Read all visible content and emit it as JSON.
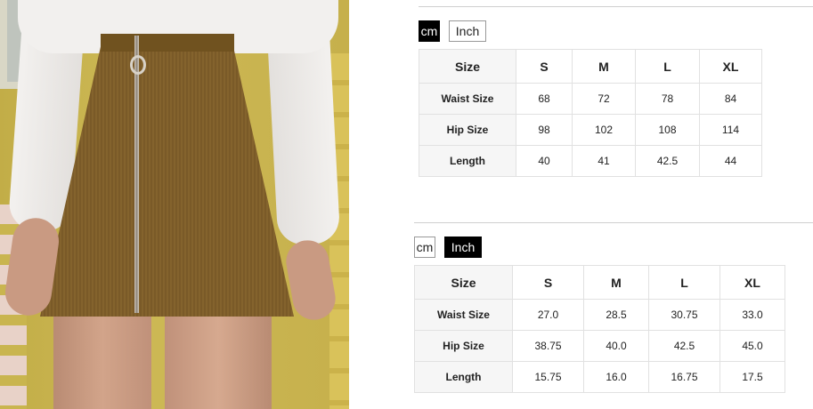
{
  "size_chart_cm": {
    "unit_buttons": {
      "cm": "cm",
      "inch": "Inch",
      "active": "cm"
    },
    "headers": [
      "Size",
      "S",
      "M",
      "L",
      "XL"
    ],
    "rows": [
      {
        "label": "Waist Size",
        "values": [
          "68",
          "72",
          "78",
          "84"
        ]
      },
      {
        "label": "Hip Size",
        "values": [
          "98",
          "102",
          "108",
          "114"
        ]
      },
      {
        "label": "Length",
        "values": [
          "40",
          "41",
          "42.5",
          "44"
        ]
      }
    ]
  },
  "size_chart_inch": {
    "unit_buttons": {
      "cm": "cm",
      "inch": "Inch",
      "active": "Inch"
    },
    "headers": [
      "Size",
      "S",
      "M",
      "L",
      "XL"
    ],
    "rows": [
      {
        "label": "Waist Size",
        "values": [
          "27.0",
          "28.5",
          "30.75",
          "33.0"
        ]
      },
      {
        "label": "Hip Size",
        "values": [
          "38.75",
          "40.0",
          "42.5",
          "45.0"
        ]
      },
      {
        "label": "Length",
        "values": [
          "15.75",
          "16.0",
          "16.75",
          "17.5"
        ]
      }
    ]
  },
  "colors": {
    "active_tab": "#000000",
    "label_cell_bg": "#f6f6f6",
    "border": "#e1e1e1",
    "skirt": "#7a5a28",
    "wall": "#c9b54f"
  }
}
